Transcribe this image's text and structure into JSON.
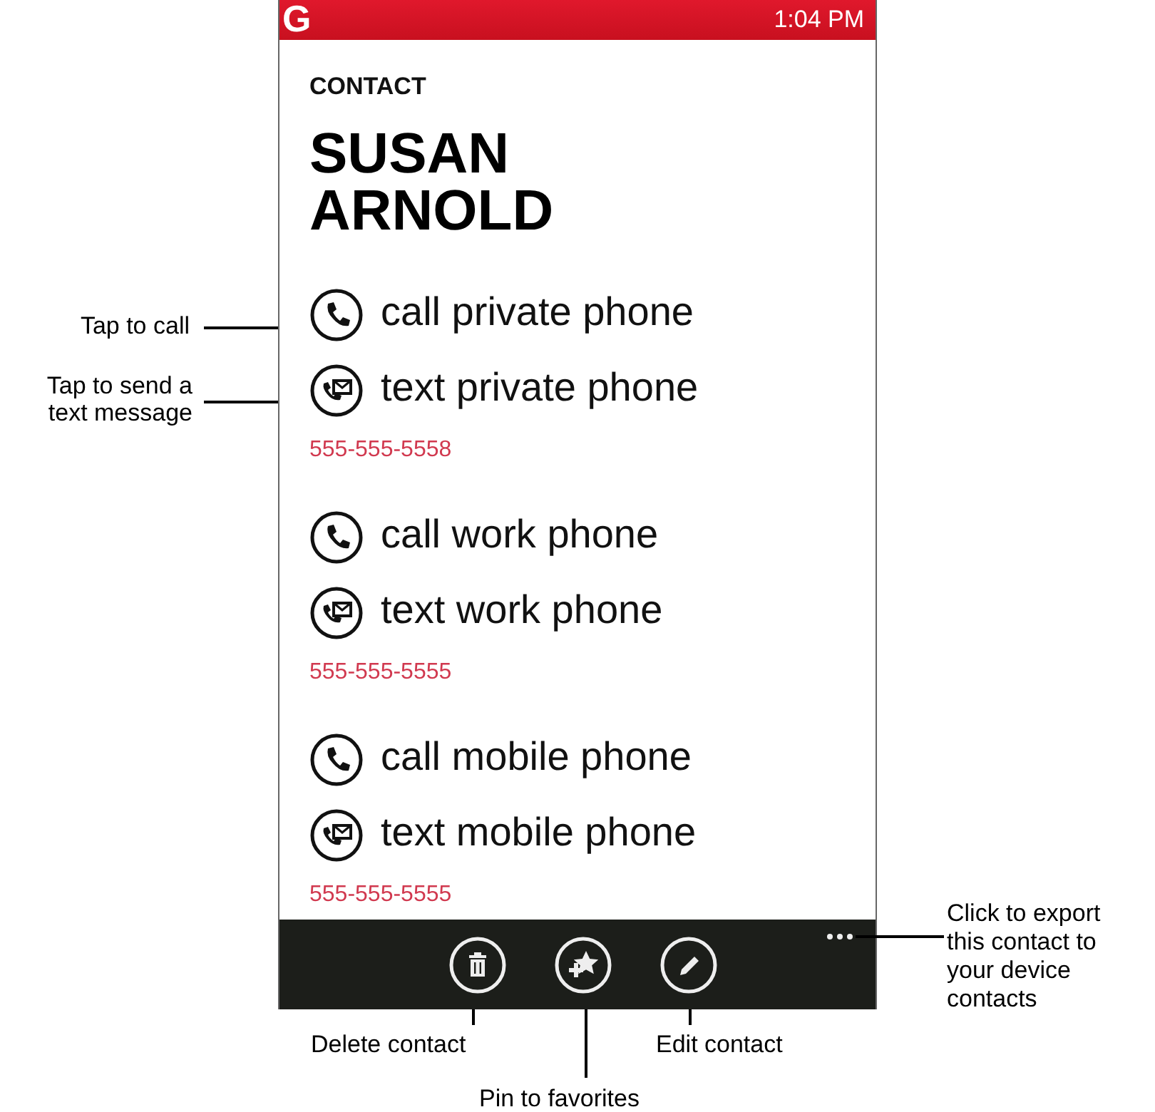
{
  "status_bar": {
    "logo": "G",
    "time": "1:04 PM"
  },
  "header": "CONTACT",
  "name_lines": [
    "SUSAN",
    "ARNOLD"
  ],
  "phones": [
    {
      "actions": [
        {
          "kind": "call",
          "label": "call private phone"
        },
        {
          "kind": "text",
          "label": "text private phone"
        }
      ],
      "number": "555-555-5558"
    },
    {
      "actions": [
        {
          "kind": "call",
          "label": "call work phone"
        },
        {
          "kind": "text",
          "label": "text work phone"
        }
      ],
      "number": "555-555-5555"
    },
    {
      "actions": [
        {
          "kind": "call",
          "label": "call mobile phone"
        },
        {
          "kind": "text",
          "label": "text mobile phone"
        }
      ],
      "number": "555-555-5555"
    }
  ],
  "app_bar": {
    "buttons": [
      {
        "kind": "delete"
      },
      {
        "kind": "pin"
      },
      {
        "kind": "edit"
      }
    ]
  },
  "callouts": [
    {
      "kind": "call",
      "text": "Tap to call"
    },
    {
      "kind": "text",
      "text": "Tap to send a text message"
    },
    {
      "kind": "more",
      "text": "Click to export this contact to your device contacts"
    },
    {
      "kind": "delete",
      "text": "Delete contact"
    },
    {
      "kind": "pin",
      "text": "Pin to favorites"
    },
    {
      "kind": "edit",
      "text": "Edit contact"
    }
  ]
}
